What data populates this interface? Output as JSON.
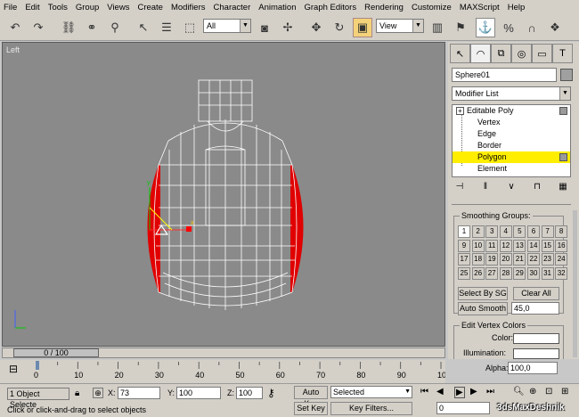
{
  "menu": [
    "File",
    "Edit",
    "Tools",
    "Group",
    "Views",
    "Create",
    "Modifiers",
    "Character",
    "Animation",
    "Graph Editors",
    "Rendering",
    "Customize",
    "MAXScript",
    "Help"
  ],
  "toolbar": {
    "selection_filter": "All",
    "reference_coord": "View",
    "icons": [
      "undo-icon",
      "redo-icon",
      "select-link-icon",
      "unlink-icon",
      "bind-spacewarp-icon",
      "select-object-icon",
      "select-by-name-icon",
      "rect-selection-icon",
      "window-crossing-icon",
      "select-move-icon",
      "select-rotate-icon",
      "select-scale-icon",
      "snap-icon",
      "angle-snap-icon",
      "percent-snap-icon",
      "spinner-snap-icon",
      "named-selection-icon",
      "mirror-icon",
      "align-icon",
      "render-icon"
    ]
  },
  "viewport": {
    "label": "Left",
    "axis_x": "x",
    "axis_y": "y",
    "accent_red": "#e00000",
    "wire_color": "#ffffff",
    "bg_color": "#8a8a8a"
  },
  "command_panel": {
    "tabs": [
      "create-tab",
      "modify-tab",
      "hierarchy-tab",
      "motion-tab",
      "display-tab",
      "utilities-tab"
    ],
    "object_name": "Sphere01",
    "modifier_list": "Modifier List",
    "stack": {
      "head": "Editable Poly",
      "plus": "+",
      "items": [
        "Vertex",
        "Edge",
        "Border",
        "Polygon",
        "Element"
      ],
      "selected_index": 3
    },
    "smoothing_groups": {
      "title": "Smoothing Groups:",
      "numbers": [
        "1",
        "2",
        "3",
        "4",
        "5",
        "6",
        "7",
        "8",
        "9",
        "10",
        "11",
        "12",
        "13",
        "14",
        "15",
        "16",
        "17",
        "18",
        "19",
        "20",
        "21",
        "22",
        "23",
        "24",
        "25",
        "26",
        "27",
        "28",
        "29",
        "30",
        "31",
        "32"
      ],
      "select_by_sg": "Select By SG",
      "clear_all": "Clear All",
      "auto_smooth": "Auto Smooth",
      "auto_smooth_value": "45,0"
    },
    "vertex_colors": {
      "title": "Edit Vertex Colors",
      "color": "Color:",
      "illumination": "Illumination:",
      "alpha": "Alpha:",
      "alpha_value": "100,0"
    }
  },
  "timeline": {
    "frame": "0 / 100",
    "ticks": [
      "0",
      "10",
      "20",
      "30",
      "40",
      "50",
      "60",
      "70",
      "80",
      "90",
      "100"
    ]
  },
  "status": {
    "selection": "1 Object Selecte",
    "x_label": "X:",
    "x_value": "73",
    "y_label": "Y:",
    "y_value": "100",
    "z_label": "Z:",
    "z_value": "100",
    "auto_key": "Auto Key",
    "key_mode": "Selected",
    "set_key": "Set Key",
    "key_filters": "Key Filters...",
    "prompt": "Click or click-and-drag to select objects",
    "frame_value": "0"
  },
  "watermark": "3dsMaxDeshnik"
}
